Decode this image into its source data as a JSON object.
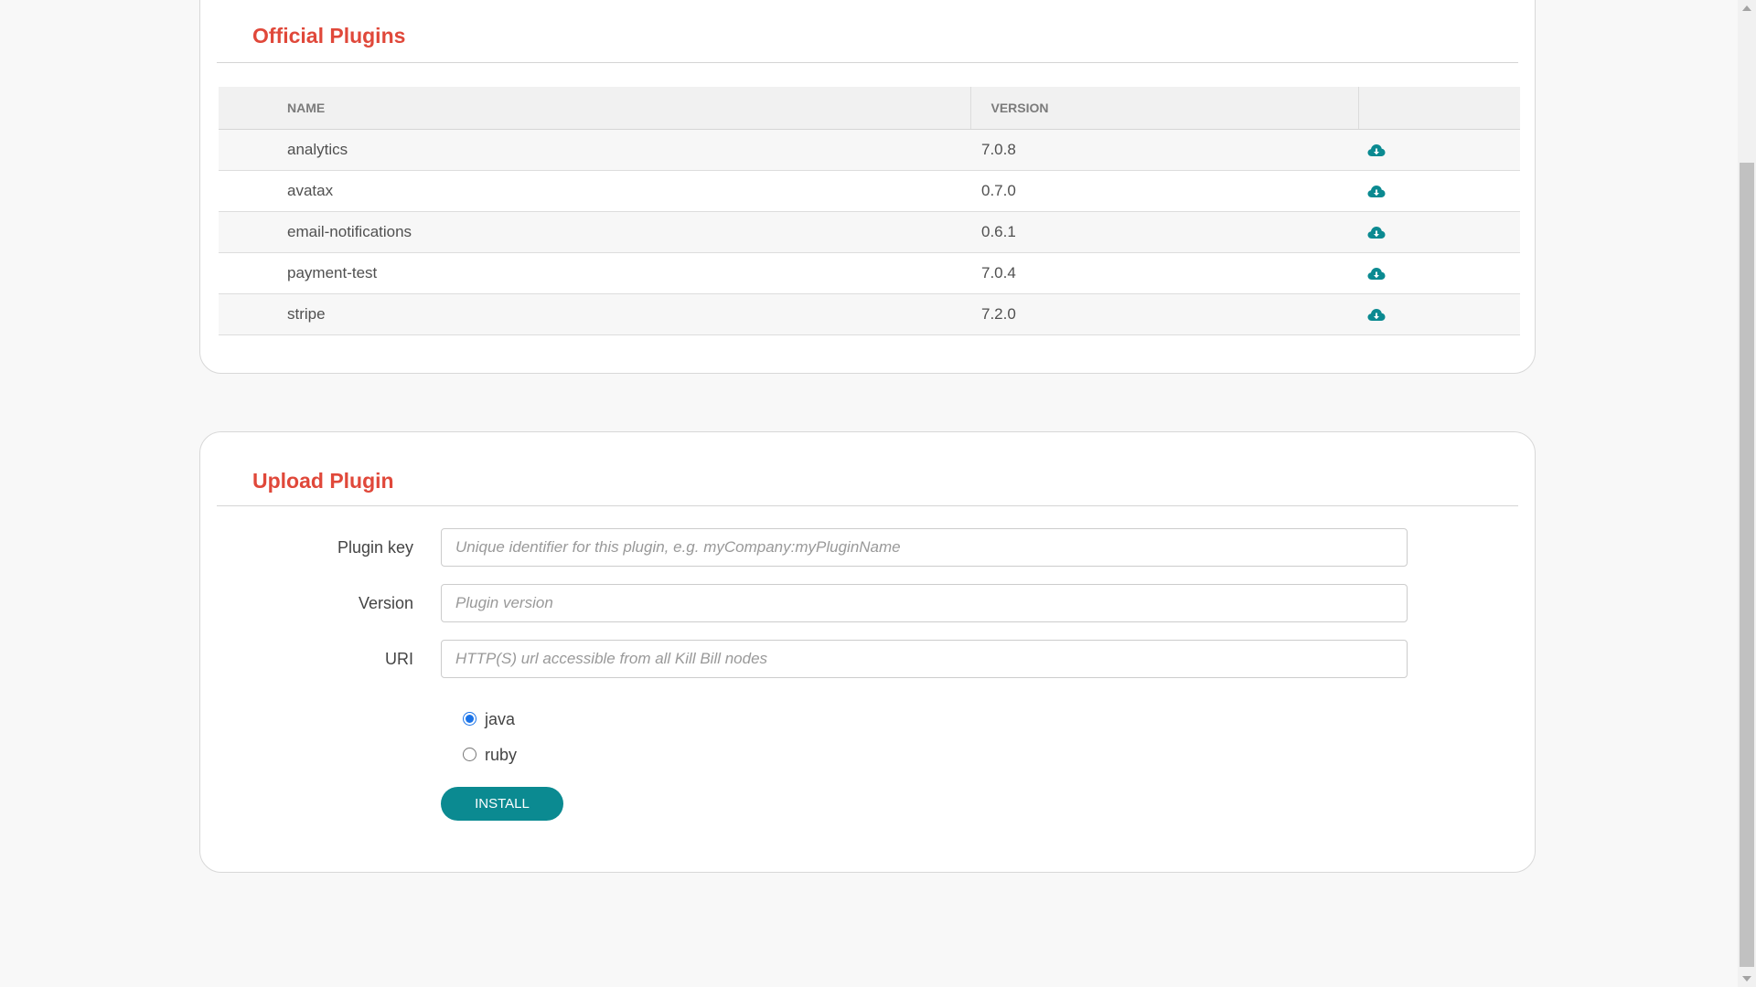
{
  "official_plugins": {
    "title": "Official Plugins",
    "columns": [
      "NAME",
      "VERSION",
      ""
    ],
    "rows": [
      {
        "name": "analytics",
        "version": "7.0.8",
        "action_icon": "cloud-download-icon"
      },
      {
        "name": "avatax",
        "version": "0.7.0",
        "action_icon": "cloud-download-icon"
      },
      {
        "name": "email-notifications",
        "version": "0.6.1",
        "action_icon": "cloud-download-icon"
      },
      {
        "name": "payment-test",
        "version": "7.0.4",
        "action_icon": "cloud-download-icon"
      },
      {
        "name": "stripe",
        "version": "7.2.0",
        "action_icon": "cloud-download-icon"
      }
    ],
    "icon_color": "#0b8a91"
  },
  "upload_plugin": {
    "title": "Upload Plugin",
    "plugin_key": {
      "label": "Plugin key",
      "placeholder": "Unique identifier for this plugin, e.g. myCompany:myPluginName",
      "value": ""
    },
    "version": {
      "label": "Version",
      "placeholder": "Plugin version",
      "value": ""
    },
    "uri": {
      "label": "URI",
      "placeholder": "HTTP(S) url accessible from all Kill Bill nodes",
      "value": ""
    },
    "language_options": [
      {
        "label": "java",
        "selected": true
      },
      {
        "label": "ruby",
        "selected": false
      }
    ],
    "install_label": "INSTALL",
    "install_color": "#0b8a91"
  },
  "colors": {
    "title_accent": "#e0483a",
    "background": "#f8f8f8"
  }
}
